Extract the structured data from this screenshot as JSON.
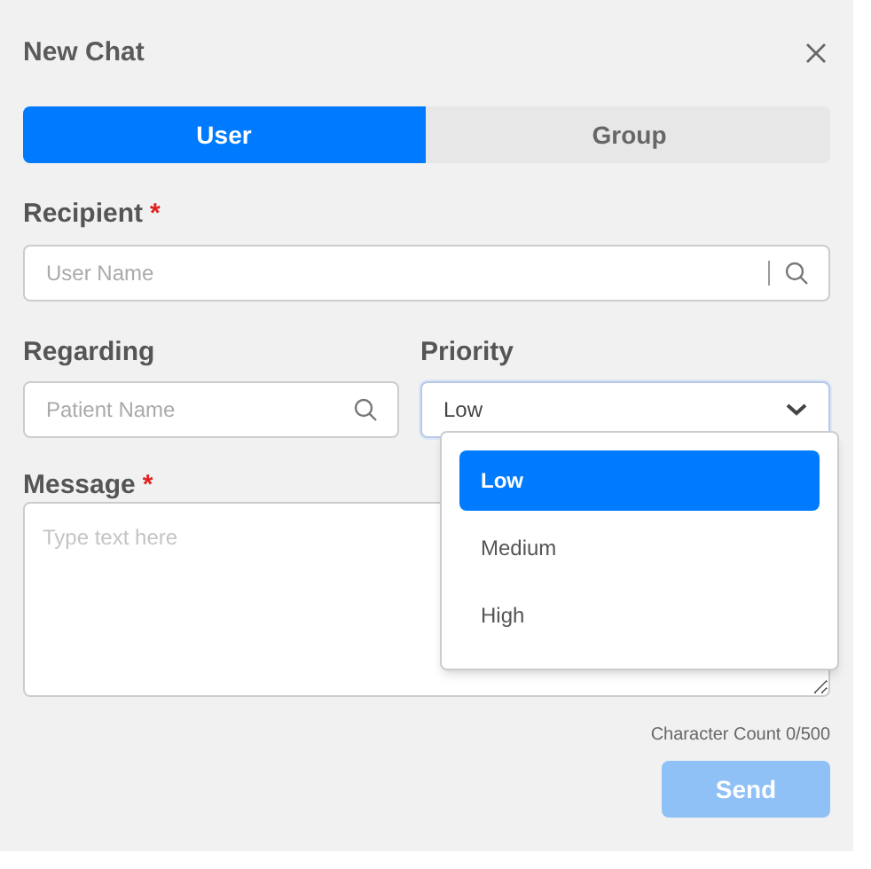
{
  "dialog": {
    "title": "New Chat"
  },
  "tabs": [
    {
      "label": "User",
      "selected": true
    },
    {
      "label": "Group",
      "selected": false
    }
  ],
  "recipient": {
    "label": "Recipient",
    "required_mark": "*",
    "placeholder": "User Name"
  },
  "regarding": {
    "label": "Regarding",
    "placeholder": "Patient Name"
  },
  "priority": {
    "label": "Priority",
    "value": "Low",
    "expanded": true,
    "options": [
      {
        "label": "Low",
        "selected": true
      },
      {
        "label": "Medium",
        "selected": false
      },
      {
        "label": "High",
        "selected": false
      }
    ]
  },
  "message": {
    "label": "Message",
    "required_mark": "*",
    "placeholder": "Type text here"
  },
  "character_count": "Character Count 0/500",
  "send_button": {
    "label": "Send",
    "disabled": true
  }
}
